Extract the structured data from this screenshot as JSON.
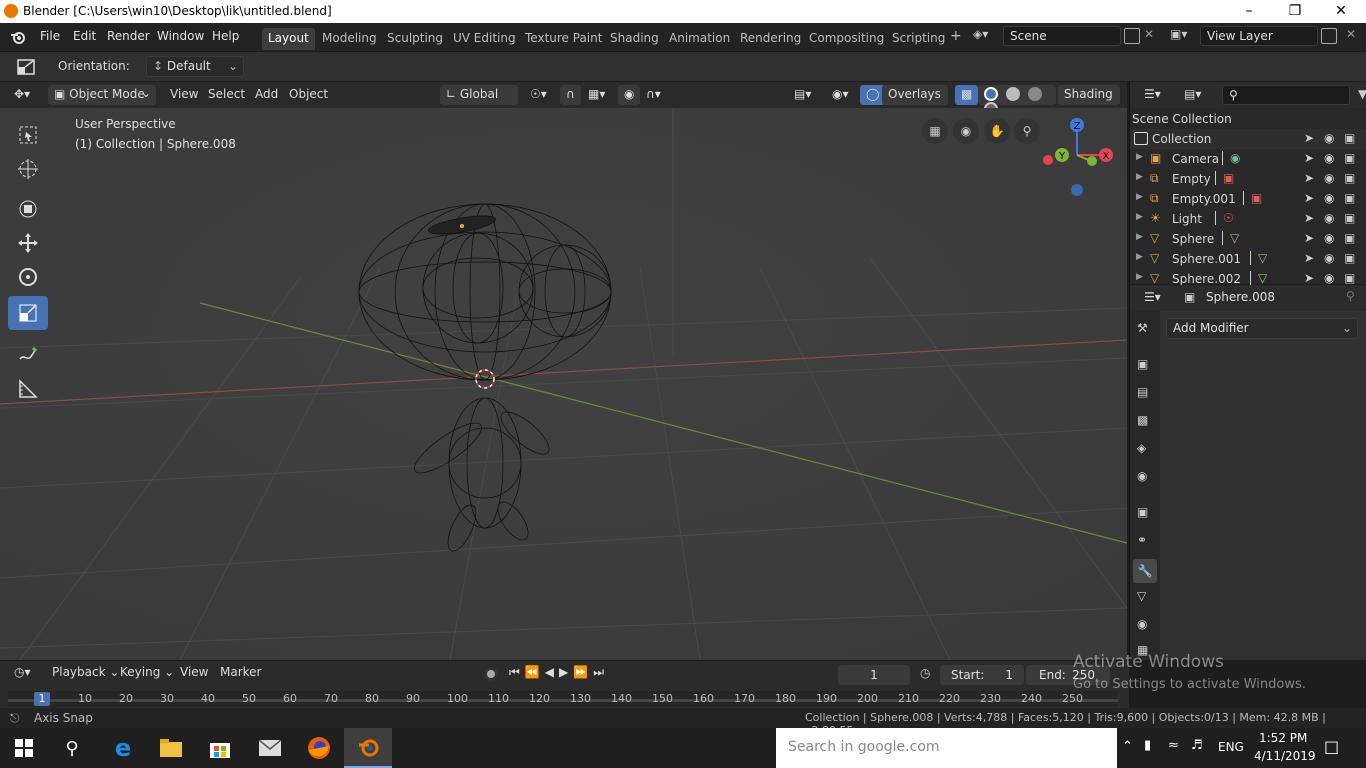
{
  "window": {
    "title": "Blender [C:\\Users\\win10\\Desktop\\lik\\untitled.blend]"
  },
  "menu": [
    "File",
    "Edit",
    "Render",
    "Window",
    "Help"
  ],
  "workspaces": [
    "Layout",
    "Modeling",
    "Sculpting",
    "UV Editing",
    "Texture Paint",
    "Shading",
    "Animation",
    "Rendering",
    "Compositing",
    "Scripting"
  ],
  "active_workspace": "Layout",
  "scene": {
    "name": "Scene",
    "view_layer": "View Layer"
  },
  "tool_options": {
    "orientation_label": "Orientation:",
    "orientation_value": "Default"
  },
  "viewport_header": {
    "mode": "Object Mode",
    "menus": [
      "View",
      "Select",
      "Add",
      "Object"
    ],
    "transform": "Global",
    "overlays": "Overlays",
    "shading": "Shading"
  },
  "viewport": {
    "perspective": "User Perspective",
    "info": "(1) Collection | Sphere.008"
  },
  "gizmo": {
    "x": "X",
    "y": "Y",
    "z": "Z"
  },
  "outliner": {
    "header": "Scene Collection",
    "collection": "Collection",
    "items": [
      {
        "name": "Camera",
        "type": "camera"
      },
      {
        "name": "Empty",
        "type": "empty"
      },
      {
        "name": "Empty.001",
        "type": "empty"
      },
      {
        "name": "Light",
        "type": "light"
      },
      {
        "name": "Sphere",
        "type": "mesh"
      },
      {
        "name": "Sphere.001",
        "type": "mesh"
      },
      {
        "name": "Sphere.002",
        "type": "mesh"
      }
    ]
  },
  "properties": {
    "object": "Sphere.008",
    "add_modifier": "Add Modifier"
  },
  "timeline": {
    "menus": [
      "Playback",
      "Keying",
      "View",
      "Marker"
    ],
    "current_frame": "1",
    "start_label": "Start:",
    "start": "1",
    "end_label": "End:",
    "end": "250",
    "ruler": [
      "1",
      "10",
      "20",
      "30",
      "40",
      "50",
      "60",
      "70",
      "80",
      "90",
      "100",
      "110",
      "120",
      "130",
      "140",
      "150",
      "160",
      "170",
      "180",
      "190",
      "200",
      "210",
      "220",
      "230",
      "240",
      "250"
    ]
  },
  "statusbar": {
    "left": "Axis Snap",
    "right": "Collection | Sphere.008 | Verts:4,788 | Faces:5,120 | Tris:9,600 | Objects:0/13 | Mem: 42.8 MB | v2.80.55"
  },
  "watermark": {
    "line1": "Activate Windows",
    "line2": "Go to Settings to activate Windows."
  },
  "taskbar": {
    "search_placeholder": "Search in google.com",
    "lang": "ENG",
    "time": "1:52 PM",
    "date": "4/11/2019"
  },
  "colors": {
    "accent": "#4772b3",
    "blender_orange": "#ea7600",
    "x_axis": "#e84350",
    "y_axis": "#7fb631",
    "z_axis": "#3b7ce3"
  }
}
